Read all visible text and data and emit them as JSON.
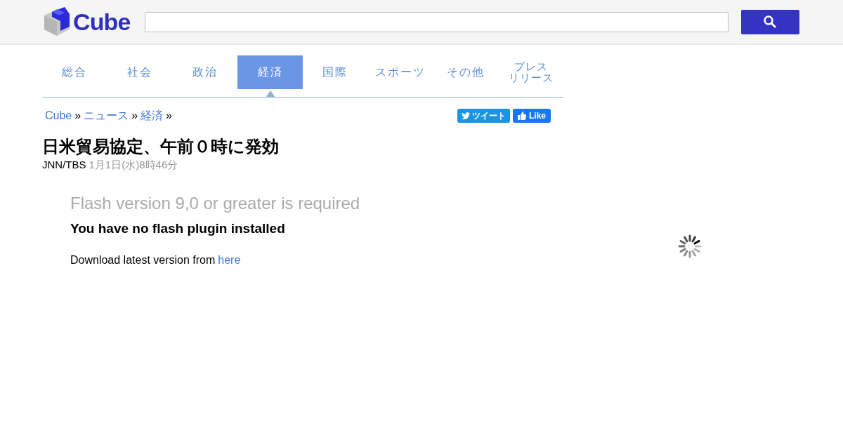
{
  "header": {
    "logo_text": "Cube"
  },
  "tabs": [
    {
      "lines": [
        "総合"
      ],
      "selected": false
    },
    {
      "lines": [
        "社会"
      ],
      "selected": false
    },
    {
      "lines": [
        "政治"
      ],
      "selected": false
    },
    {
      "lines": [
        "経済"
      ],
      "selected": true
    },
    {
      "lines": [
        "国際"
      ],
      "selected": false
    },
    {
      "lines": [
        "スポーツ"
      ],
      "selected": false
    },
    {
      "lines": [
        "その他"
      ],
      "selected": false
    },
    {
      "lines": [
        "プレス",
        "リリース"
      ],
      "selected": false
    }
  ],
  "breadcrumbs": [
    {
      "label": "Cube",
      "separator": "»"
    },
    {
      "label": "ニュース",
      "separator": "»"
    },
    {
      "label": "経済",
      "separator": "»"
    }
  ],
  "share": {
    "tweet": "ツイート",
    "like": "Like"
  },
  "article": {
    "title": "日米貿易協定、午前０時に発効",
    "source": "JNN/TBS",
    "date": "1月1日(水)8時46分"
  },
  "flash": {
    "heading": "Flash version 9,0 or greater is required",
    "subheading": "You have no flash plugin installed",
    "download_text": "Download latest version from",
    "download_link": "here"
  }
}
